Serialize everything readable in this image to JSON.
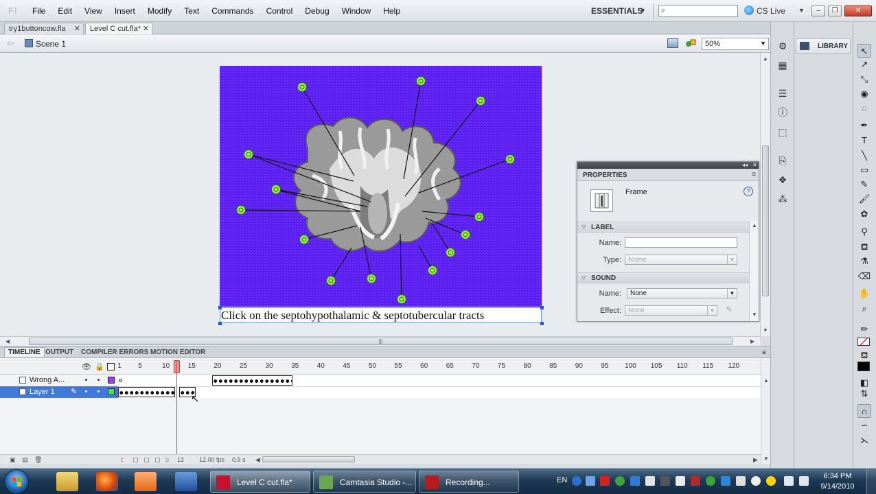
{
  "app": {
    "logo": "Fl",
    "menus": [
      "File",
      "Edit",
      "View",
      "Insert",
      "Modify",
      "Text",
      "Commands",
      "Control",
      "Debug",
      "Window",
      "Help"
    ],
    "workspace": "ESSENTIALS",
    "cs_live": "CS Live"
  },
  "doc_tabs": [
    {
      "label": "try1buttoncow.fla",
      "active": false
    },
    {
      "label": "Level C cut.fla*",
      "active": true
    }
  ],
  "editbar": {
    "scene": "Scene 1",
    "zoom": "50%"
  },
  "stage": {
    "background_color": "#5a1ef3",
    "caption": "Click on the septohypothalamic & septotubercular tracts",
    "hotspot_color": "#9ef04a",
    "hotspot_count": 17
  },
  "properties": {
    "tab": "PROPERTIES",
    "type_label": "Frame",
    "label_section": "LABEL",
    "name_label": "Name:",
    "name_value": "",
    "type_field_label": "Type:",
    "type_value": "Name",
    "sound_section": "SOUND",
    "sound_name_label": "Name:",
    "sound_name_value": "None",
    "effect_label": "Effect:",
    "effect_value": "None"
  },
  "library": {
    "label": "LIBRARY"
  },
  "timeline": {
    "tabs": [
      "TIMELINE",
      "OUTPUT",
      "COMPILER ERRORS",
      "MOTION EDITOR"
    ],
    "ruler": [
      "1",
      "5",
      "10",
      "15",
      "20",
      "25",
      "30",
      "35",
      "40",
      "45",
      "50",
      "55",
      "60",
      "65",
      "70",
      "75",
      "80",
      "85",
      "90",
      "95",
      "100",
      "105",
      "110",
      "115",
      "120"
    ],
    "current_frame": 12,
    "current_frame_label": "12",
    "fps": "12.00 fps",
    "elapsed": "0.9 s",
    "layers": [
      {
        "name": "Wrong A...",
        "color": "#a23cf0",
        "selected": false
      },
      {
        "name": "Layer 1",
        "color": "#45e45a",
        "selected": true
      }
    ]
  },
  "taskbar": {
    "tasks": [
      {
        "label": "Level C cut.fla*",
        "active": true,
        "icon_color": "#c8102e"
      },
      {
        "label": "Camtasia Studio -...",
        "active": false,
        "icon_color": "#6aa84f"
      },
      {
        "label": "Recording...",
        "active": false,
        "icon_color": "#b71c1c"
      }
    ],
    "language": "EN",
    "time": "6:34 PM",
    "date": "9/14/2010"
  }
}
